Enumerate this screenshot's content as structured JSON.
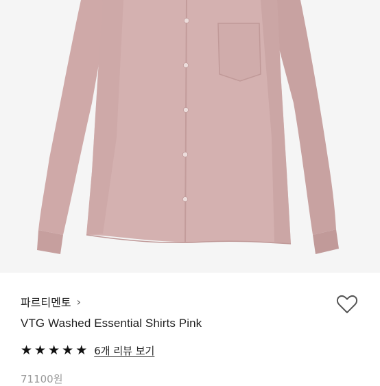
{
  "product": {
    "brand": "파르티멘토",
    "brand_chevron": "›",
    "name": "VTG Washed Essential Shirts Pink",
    "rating_stars": 5,
    "review_link": "6개 리뷰 보기",
    "price": "71100원",
    "shirt_color": "#d4b1b0",
    "heart_icon": "heart-outline-icon"
  }
}
